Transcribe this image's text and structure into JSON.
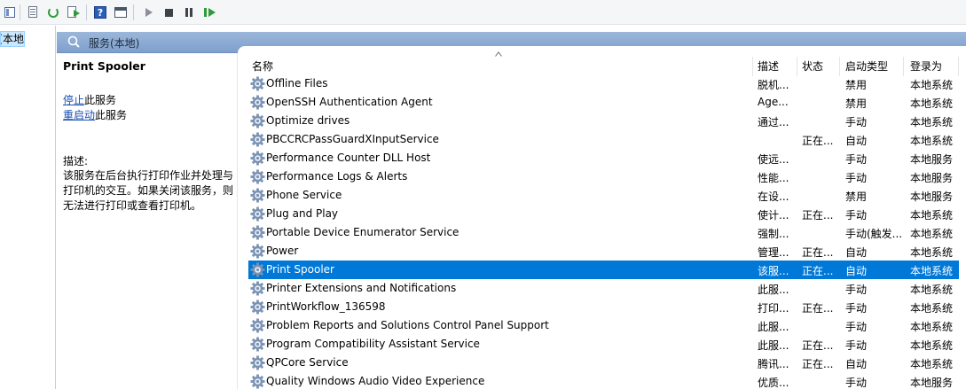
{
  "toolbar": {
    "buttons": [
      "console-tree-icon",
      "properties-icon",
      "refresh-icon",
      "export-list-icon",
      "help-icon",
      "show-action-pane-icon",
      "start-service-icon",
      "stop-service-icon",
      "pause-service-icon",
      "resume-service-icon"
    ]
  },
  "tree": {
    "selected_label": "服务(本地)",
    "visible_fragment": "本地)"
  },
  "header": {
    "title": "服务(本地)"
  },
  "details": {
    "service_title": "Print Spooler",
    "stop_link": "停止",
    "stop_suffix": "此服务",
    "restart_link": "重启动",
    "restart_suffix": "此服务",
    "description_label": "描述:",
    "description_text": "该服务在后台执行打印作业并处理与打印机的交互。如果关闭该服务，则无法进行打印或查看打印机。"
  },
  "list": {
    "columns": {
      "name": "名称",
      "description": "描述",
      "status": "状态",
      "startup": "启动类型",
      "logon": "登录为"
    },
    "selected_index": 10,
    "selection_color": "#0078d7",
    "rows": [
      {
        "name": "Offline Files",
        "desc": "脱机...",
        "status": "",
        "startup": "禁用",
        "logon": "本地系统"
      },
      {
        "name": "OpenSSH Authentication Agent",
        "desc": "Age...",
        "status": "",
        "startup": "禁用",
        "logon": "本地系统"
      },
      {
        "name": "Optimize drives",
        "desc": "通过...",
        "status": "",
        "startup": "手动",
        "logon": "本地系统"
      },
      {
        "name": "PBCCRCPassGuardXInputService",
        "desc": "",
        "status": "正在...",
        "startup": "自动",
        "logon": "本地系统"
      },
      {
        "name": "Performance Counter DLL Host",
        "desc": "使远...",
        "status": "",
        "startup": "手动",
        "logon": "本地服务"
      },
      {
        "name": "Performance Logs & Alerts",
        "desc": "性能...",
        "status": "",
        "startup": "手动",
        "logon": "本地服务"
      },
      {
        "name": "Phone Service",
        "desc": "在设...",
        "status": "",
        "startup": "禁用",
        "logon": "本地服务"
      },
      {
        "name": "Plug and Play",
        "desc": "使计...",
        "status": "正在...",
        "startup": "手动",
        "logon": "本地系统"
      },
      {
        "name": "Portable Device Enumerator Service",
        "desc": "强制...",
        "status": "",
        "startup": "手动(触发...",
        "logon": "本地系统"
      },
      {
        "name": "Power",
        "desc": "管理...",
        "status": "正在...",
        "startup": "自动",
        "logon": "本地系统"
      },
      {
        "name": "Print Spooler",
        "desc": "该服...",
        "status": "正在...",
        "startup": "自动",
        "logon": "本地系统"
      },
      {
        "name": "Printer Extensions and Notifications",
        "desc": "此服...",
        "status": "",
        "startup": "手动",
        "logon": "本地系统"
      },
      {
        "name": "PrintWorkflow_136598",
        "desc": "打印...",
        "status": "正在...",
        "startup": "手动",
        "logon": "本地系统"
      },
      {
        "name": "Problem Reports and Solutions Control Panel Support",
        "desc": "此服...",
        "status": "",
        "startup": "手动",
        "logon": "本地系统"
      },
      {
        "name": "Program Compatibility Assistant Service",
        "desc": "此服...",
        "status": "正在...",
        "startup": "手动",
        "logon": "本地系统"
      },
      {
        "name": "QPCore Service",
        "desc": "腾讯...",
        "status": "正在...",
        "startup": "自动",
        "logon": "本地系统"
      },
      {
        "name": "Quality Windows Audio Video Experience",
        "desc": "优质...",
        "status": "",
        "startup": "手动",
        "logon": "本地服务"
      }
    ]
  }
}
